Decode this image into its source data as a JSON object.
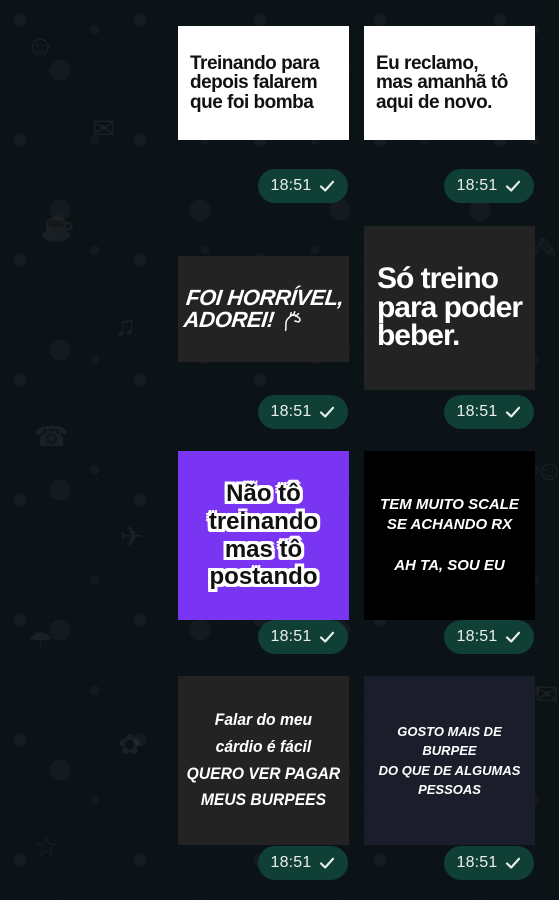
{
  "chat": {
    "stickers": [
      {
        "text": "Treinando para\ndepois falarem\nque foi bomba",
        "time": "18:51"
      },
      {
        "text": "Eu reclamo,\nmas amanhã tô\naqui de novo.",
        "time": "18:51"
      },
      {
        "text": "FOI HORRÍVEL,\nADOREI!",
        "time": "18:51"
      },
      {
        "text": "Só treino\npara poder\nbeber.",
        "time": "18:51"
      },
      {
        "text": "Não tô\ntreinando\nmas tô\npostando",
        "time": "18:51"
      },
      {
        "text": "TEM MUITO SCALE\nSE ACHANDO RX\n\nAH TA, SOU EU",
        "time": "18:51"
      },
      {
        "text": "Falar do meu\ncárdio é fácil\nQUERO VER PAGAR\nMEUS BURPEES",
        "time": "18:51"
      },
      {
        "text": "GOSTO MAIS DE\nBURPEE\nDO QUE DE ALGUMAS\nPESSOAS",
        "time": "18:51"
      }
    ]
  },
  "colors": {
    "background": "#0c1317",
    "stamp_background": "#0f3f35",
    "stamp_text": "#e9edef",
    "purple_sticker": "#7a35f3"
  },
  "icons": {
    "read_check": "check-icon"
  }
}
